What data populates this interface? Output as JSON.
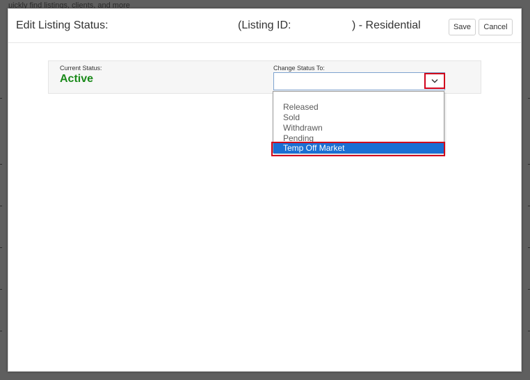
{
  "background": {
    "partial_text": "uickly find listings, clients, and more"
  },
  "modal": {
    "title": "Edit Listing Status:",
    "listing_id_prefix": "(Listing ID:",
    "listing_id_suffix": ") - Residential",
    "save_label": "Save",
    "cancel_label": "Cancel"
  },
  "status": {
    "current_label": "Current Status:",
    "current_value": "Active",
    "change_label": "Change Status To:",
    "selected_value": ""
  },
  "dropdown": {
    "options": [
      {
        "label": "Released"
      },
      {
        "label": "Sold"
      },
      {
        "label": "Withdrawn"
      },
      {
        "label": "Pending"
      },
      {
        "label": "Temp Off Market"
      }
    ],
    "highlighted_option": "Temp Off Market"
  },
  "colors": {
    "active_status": "#1a8a1a",
    "selection_blue": "#1a6fd3",
    "annotation_red": "#d0021b"
  },
  "icons": {
    "dropdown_toggle": "chevron-down-icon"
  }
}
